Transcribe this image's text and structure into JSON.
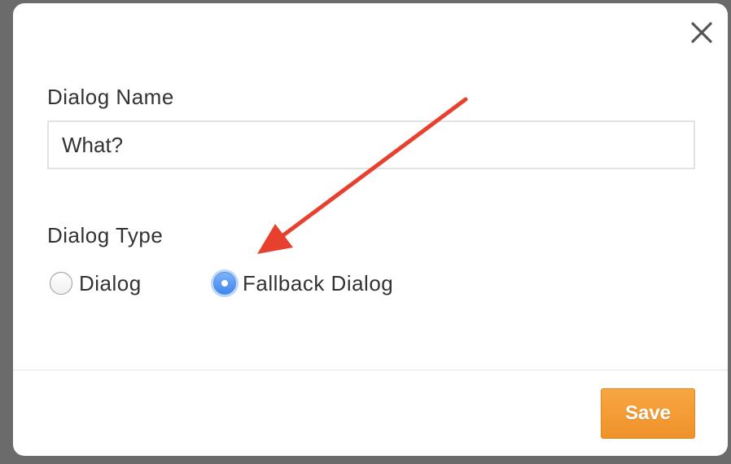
{
  "dialog": {
    "name_label": "Dialog Name",
    "name_value": "What?",
    "type_label": "Dialog Type",
    "type_options": [
      {
        "label": "Dialog",
        "selected": false
      },
      {
        "label": "Fallback Dialog",
        "selected": true
      }
    ],
    "save_label": "Save",
    "close_icon": "close-icon"
  },
  "colors": {
    "accent_button": "#f29a33",
    "radio_selected": "#4f8fe6",
    "annotation_arrow": "#e8402f"
  }
}
